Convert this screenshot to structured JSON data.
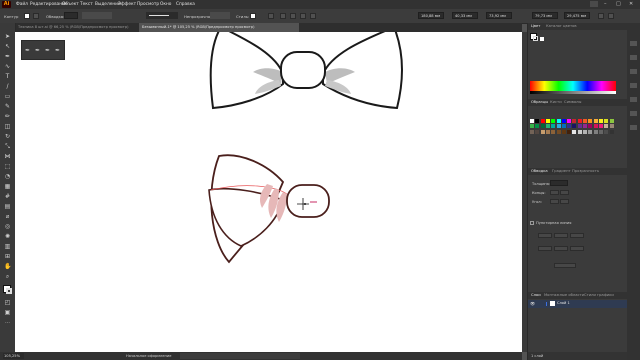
{
  "app": {
    "logo_text": "Ai"
  },
  "menu": [
    "Файл",
    "Редактирование",
    "Объект",
    "Текст",
    "Выделение",
    "Эффект",
    "Просмотр",
    "Окно",
    "Справка"
  ],
  "control_bar": {
    "selection_label": "Контур",
    "stroke_label": "Обводка:",
    "opacity_label": "Непрозрачность",
    "style_label": "Стиль:",
    "x_value": "180,88 мм",
    "y_value": "40,33 мм",
    "w_value": "73,92 мм",
    "h_value": "79,73 мм",
    "angle_value": "29,475 мм"
  },
  "tabs": [
    {
      "label": "Техника 8 шт.ai @ 66,25 % (RGB/Предпросмотр просмотр)",
      "active": false
    },
    {
      "label": "Безымянный-1* @ 105,25 % (RGB/Предпросмотр просмотр)",
      "active": true
    }
  ],
  "status": {
    "zoom": "105,25%",
    "tool_name": "Начальное оформление"
  },
  "right_panel": {
    "color_tabs": [
      "Цвет",
      "Каталог цветов"
    ],
    "swatch_tabs": [
      "Образцы",
      "Кисти",
      "Символы"
    ],
    "stroke_tabs": [
      "Обводка",
      "Градиент",
      "Прозрачность"
    ],
    "stroke_labels": [
      "Толщина:",
      "Концы:",
      "Угол:"
    ],
    "dashed_label": "Пунктирная линия",
    "layer_tabs": [
      "Слои",
      "Монтажные области",
      "Стили графики"
    ],
    "layer_name": "Слой 1",
    "layer_status": "1 слой"
  },
  "colors": {
    "accent": "#ff9a00",
    "bow_outline": "#4a1f1c",
    "layer_color": "#3b6fe0",
    "selection": "#e8585a"
  }
}
